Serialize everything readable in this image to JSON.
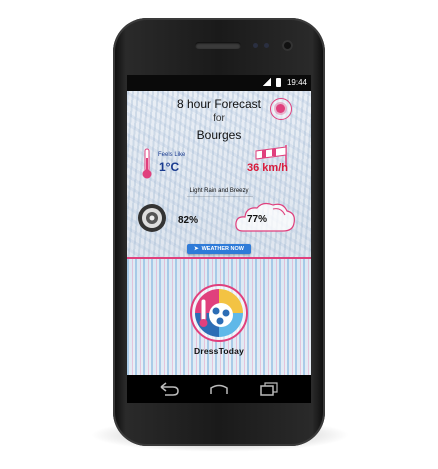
{
  "status_bar": {
    "time": "19:44"
  },
  "forecast": {
    "title": "8 hour Forecast",
    "connector": "for",
    "city": "Bourges"
  },
  "feels_like": {
    "label": "Feels Like",
    "value": "1°C"
  },
  "wind": {
    "speed": "36 km/h"
  },
  "condition": {
    "text": "Light Rain and Breezy"
  },
  "humidity": {
    "value": "82%"
  },
  "cloud_cover": {
    "value": "77%"
  },
  "actions": {
    "weather_now_label": "WEATHER NOW"
  },
  "brand": {
    "name": "DressToday"
  },
  "colors": {
    "accent": "#e0407d",
    "button": "#2f7bd8",
    "wind_text": "#d81b3b",
    "feels_text": "#1a3b8f"
  },
  "icons": [
    "settings-icon",
    "thermometer-icon",
    "wind-sock-icon",
    "humidity-gauge-icon",
    "cloud-icon",
    "dresstoday-logo-icon",
    "back-icon",
    "home-icon",
    "recents-icon"
  ]
}
